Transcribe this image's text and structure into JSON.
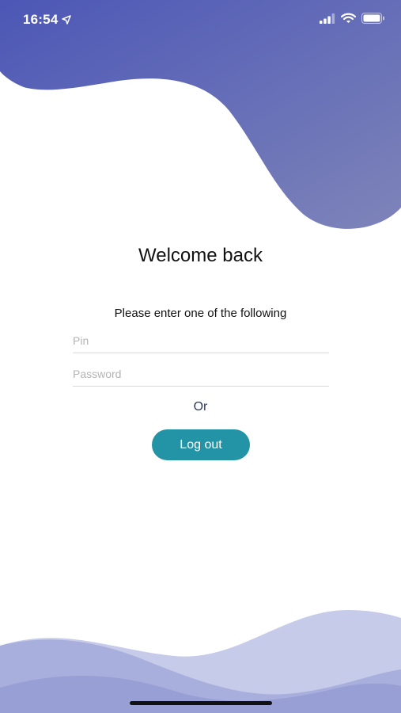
{
  "status_bar": {
    "time": "16:54",
    "icons": [
      "location-arrow-icon",
      "cellular-signal-icon",
      "wifi-icon",
      "battery-icon"
    ]
  },
  "login": {
    "title": "Welcome back",
    "instruction": "Please enter one of the following",
    "pin_placeholder": "Pin",
    "password_placeholder": "Password",
    "or_label": "Or",
    "logout_label": "Log out"
  },
  "theme": {
    "wave_top_start": "#4c57b6",
    "wave_top_end": "#7a7fb8",
    "wave_bottom": "#9aa1d8",
    "button_color": "#2393a6"
  }
}
